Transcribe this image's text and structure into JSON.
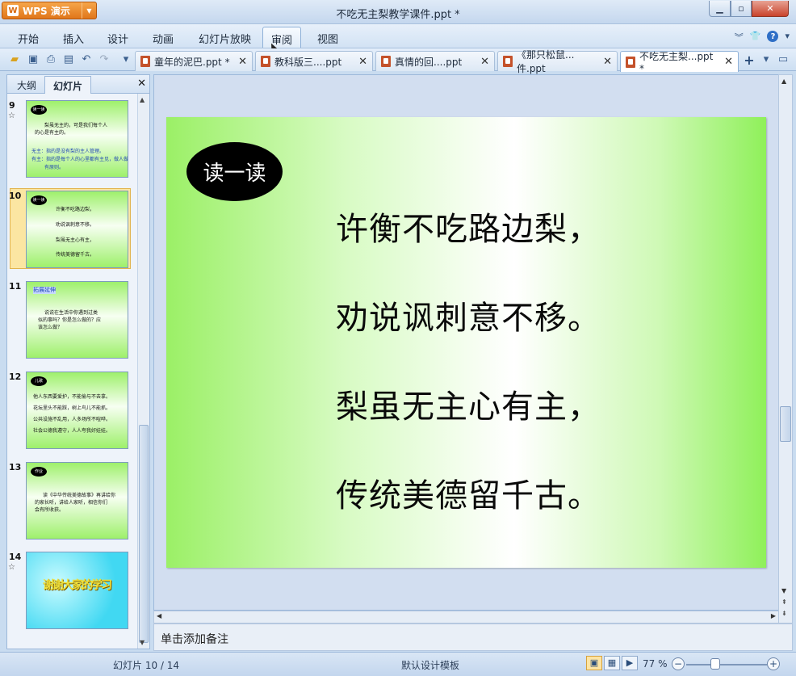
{
  "app": {
    "menu_button": "WPS 演示",
    "logo_glyph": "W",
    "window_title": "不吃无主梨教学课件.ppt *"
  },
  "menu": {
    "items": [
      "开始",
      "插入",
      "设计",
      "动画",
      "幻灯片放映",
      "审阅",
      "视图"
    ],
    "active": "审阅"
  },
  "tabs": [
    {
      "label": "童年的泥巴.ppt *"
    },
    {
      "label": "教科版三....ppt"
    },
    {
      "label": "真情的回....ppt"
    },
    {
      "label": "《那只松鼠...件.ppt"
    },
    {
      "label": "不吃无主梨...ppt *",
      "active": true
    }
  ],
  "left_panel": {
    "tab_outline": "大纲",
    "tab_slides": "幻灯片",
    "close_glyph": "✕",
    "slides": [
      {
        "num": "9",
        "star": "☆",
        "oval": "读一读",
        "lines": [
          "梨虽无主的，可是我们每个人",
          "的心是有主的。"
        ],
        "blue_lines": [
          "无主：指的是没有梨的主人管理。",
          "有主：指的是每个人的心里都有主见，做人做事",
          "有原则。"
        ]
      },
      {
        "num": "10",
        "oval": "读一读",
        "lines": [
          "许衡不吃路边梨，",
          "劝说讽刺意不移。",
          "梨虽无主心有主，",
          "传统美德留千古。"
        ]
      },
      {
        "num": "11",
        "heading": "拓展延伸",
        "lines": [
          "说说在生活中你遇到过类",
          "似的事吗？你是怎么做的？应",
          "该怎么做？"
        ]
      },
      {
        "num": "12",
        "oval": "儿歌",
        "lines": [
          "他人东西要爱护，不能偷与不去拿。",
          "花坛里头不能踩，树上鸟儿不能抓。",
          "公共设施不乱用，人多场所不喧哗。",
          "社会公德我遵守，人人夸我好娃娃。"
        ]
      },
      {
        "num": "13",
        "oval": "作业",
        "lines": [
          "读《中华传统美德故事》再讲给你",
          "的家长听，讲给人家听，相信你们",
          "会有所收获。"
        ]
      },
      {
        "num": "14",
        "star": "☆",
        "banner": "谢谢大家的学习"
      }
    ]
  },
  "slide": {
    "badge": "读一读",
    "lines": [
      "许衡不吃路边梨，",
      "劝说讽刺意不移。",
      "梨虽无主心有主，",
      "传统美德留千古。"
    ]
  },
  "notes": {
    "placeholder": "单击添加备注"
  },
  "status": {
    "slide_counter": "幻灯片 10 / 14",
    "template": "默认设计模板",
    "zoom": "77 %"
  },
  "colors": {
    "slide_green": "#9bf066",
    "accent_orange": "#e0761a",
    "selection_yellow": "#fbe6a2"
  }
}
